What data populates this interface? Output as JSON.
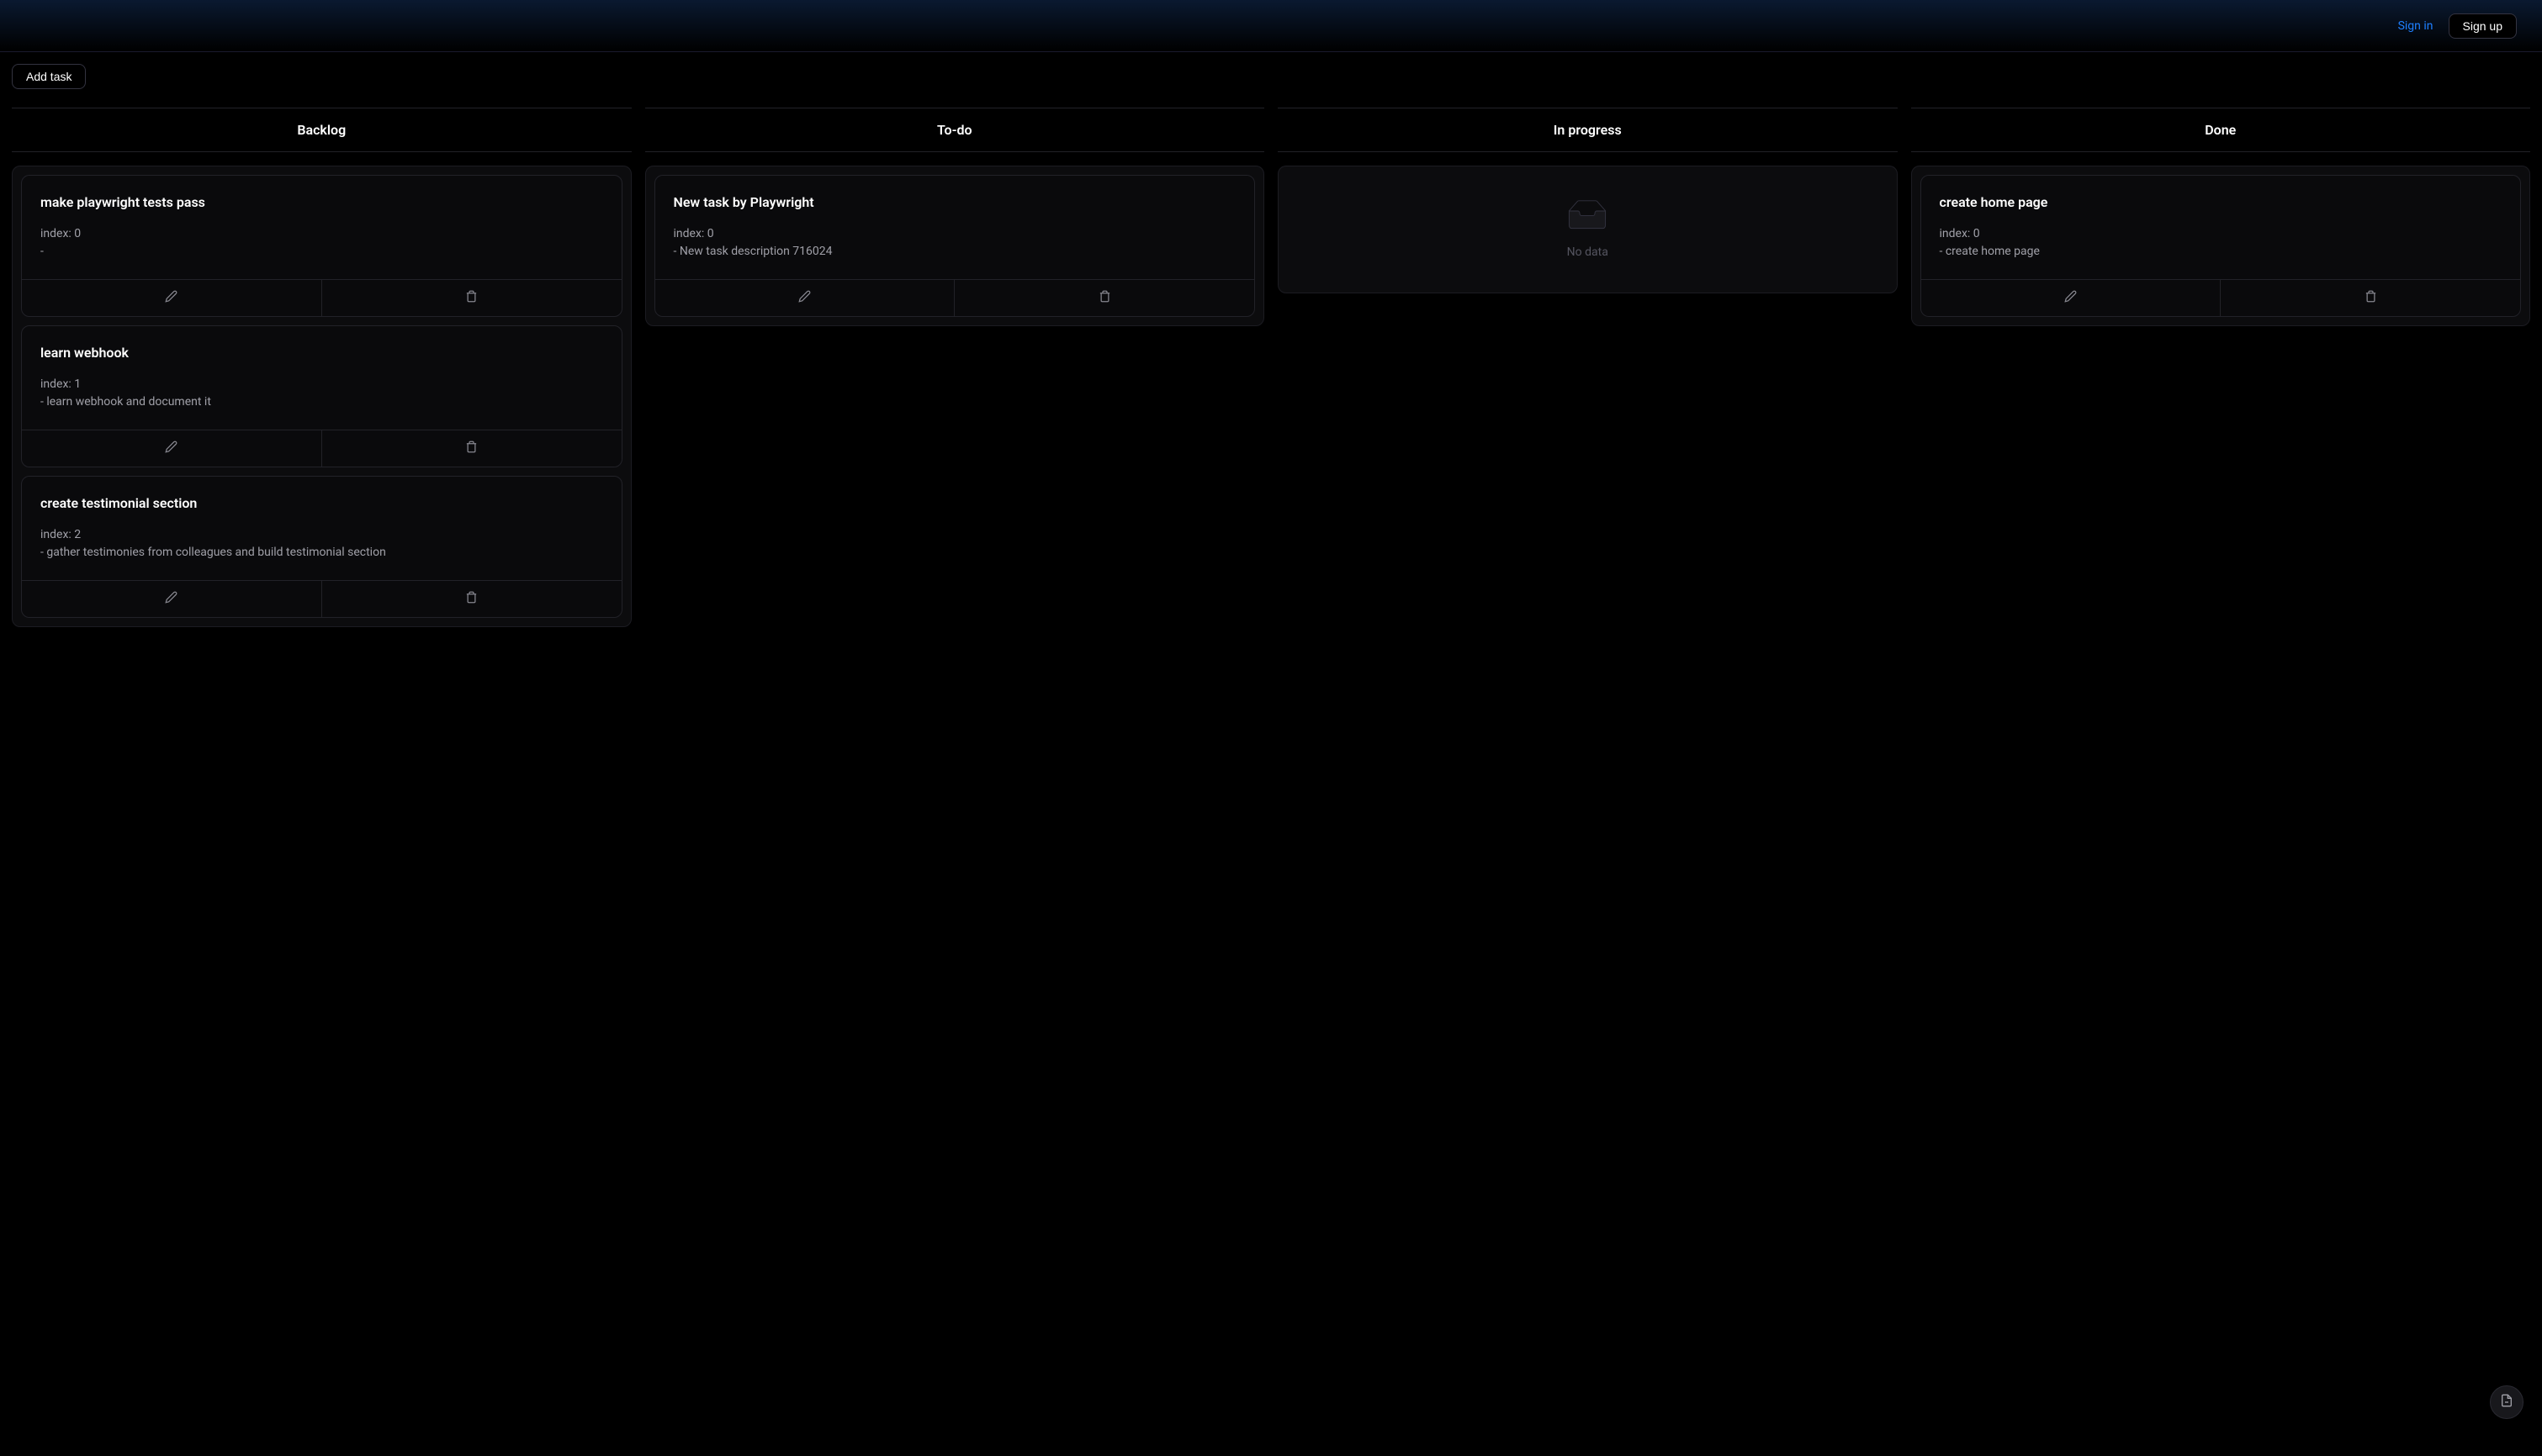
{
  "header": {
    "sign_in": "Sign in",
    "sign_up": "Sign up"
  },
  "toolbar": {
    "add_task": "Add task"
  },
  "columns": [
    {
      "title": "Backlog",
      "cards": [
        {
          "title": "make playwright tests pass",
          "index_line": "index: 0",
          "description": "-"
        },
        {
          "title": "learn webhook",
          "index_line": "index: 1",
          "description": "- learn webhook and document it"
        },
        {
          "title": "create testimonial section",
          "index_line": "index: 2",
          "description": "- gather testimonies from colleagues and build testimonial section"
        }
      ]
    },
    {
      "title": "To-do",
      "cards": [
        {
          "title": "New task by Playwright",
          "index_line": "index: 0",
          "description": "- New task description 716024"
        }
      ]
    },
    {
      "title": "In progress",
      "empty": "No data",
      "cards": []
    },
    {
      "title": "Done",
      "cards": [
        {
          "title": "create home page",
          "index_line": "index: 0",
          "description": "- create home page"
        }
      ]
    }
  ]
}
